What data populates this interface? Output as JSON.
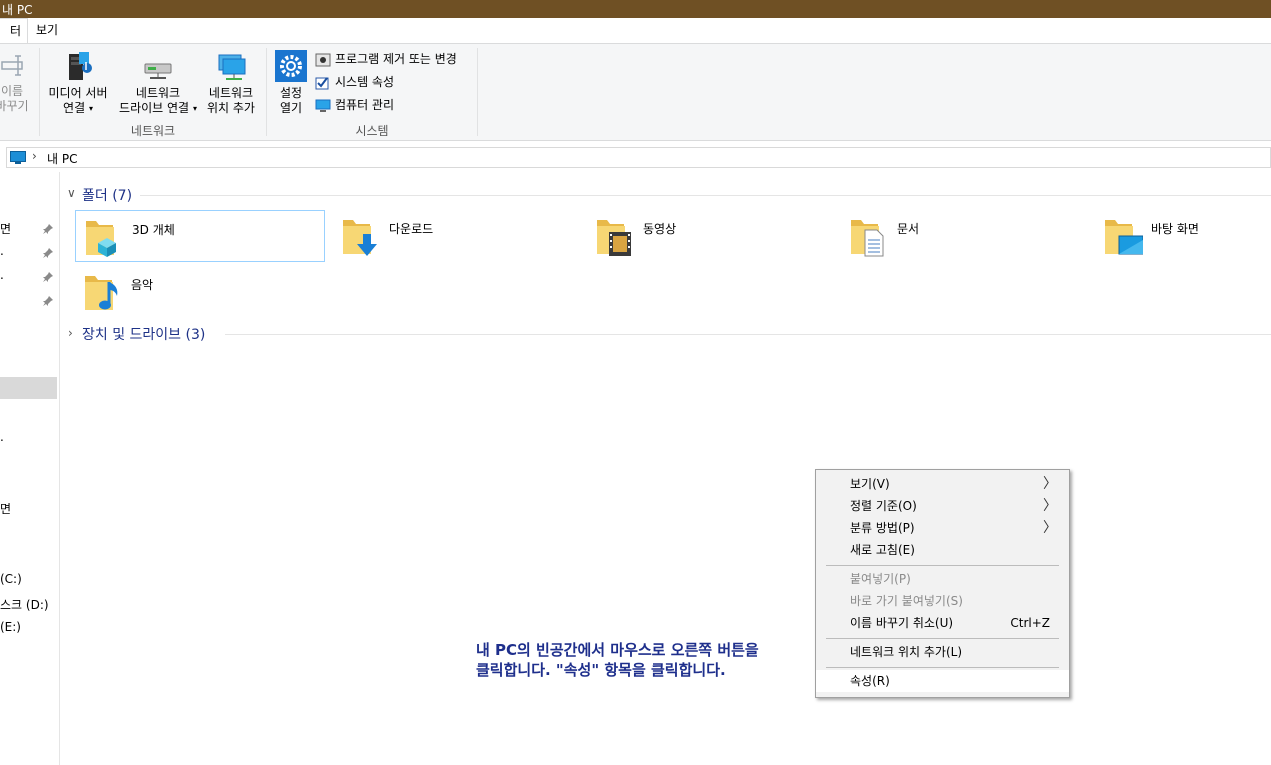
{
  "window": {
    "title": "내 PC"
  },
  "tabs": {
    "file": "터",
    "view": "보기"
  },
  "ribbon": {
    "rename": {
      "line1": "이름",
      "line2": "바꾸기"
    },
    "media_server": {
      "line1": "미디어 서버",
      "line2": "연결"
    },
    "map_drive": {
      "line1": "네트워크",
      "line2": "드라이브 연결"
    },
    "add_location": {
      "line1": "네트워크",
      "line2": "위치 추가"
    },
    "network_group": "네트워크",
    "settings": {
      "line1": "설정",
      "line2": "열기"
    },
    "uninstall": "프로그램 제거 또는 변경",
    "system_props": "시스템 속성",
    "manage": "컴퓨터 관리",
    "system_group": "시스템"
  },
  "address": {
    "crumb": "내 PC"
  },
  "nav": {
    "items": [
      "면",
      "",
      "",
      "",
      "",
      "면",
      "(C:)",
      "스크 (D:)",
      "(E:)"
    ]
  },
  "sections": {
    "folders": "폴더 (7)",
    "drives": "장치 및 드라이브 (3)"
  },
  "folders": [
    "3D 개체",
    "다운로드",
    "동영상",
    "문서",
    "바탕 화면",
    "음악"
  ],
  "note": {
    "line1": "내 PC의 빈공간에서 마우스로 오른쪽 버튼을",
    "line2": "클릭합니다. \"속성\" 항목을 클릭합니다."
  },
  "context_menu": {
    "view": "보기(V)",
    "sort": "정렬 기준(O)",
    "group": "분류 방법(P)",
    "refresh": "새로 고침(E)",
    "paste": "붙여넣기(P)",
    "paste_shortcut": "바로 가기 붙여넣기(S)",
    "undo_rename": "이름 바꾸기 취소(U)",
    "undo_shortcut": "Ctrl+Z",
    "add_network_location": "네트워크 위치 추가(L)",
    "properties": "속성(R)"
  },
  "colors": {
    "titlebar": "#6f5024",
    "accent": "#1e3287",
    "note": "#1e2f8c"
  }
}
